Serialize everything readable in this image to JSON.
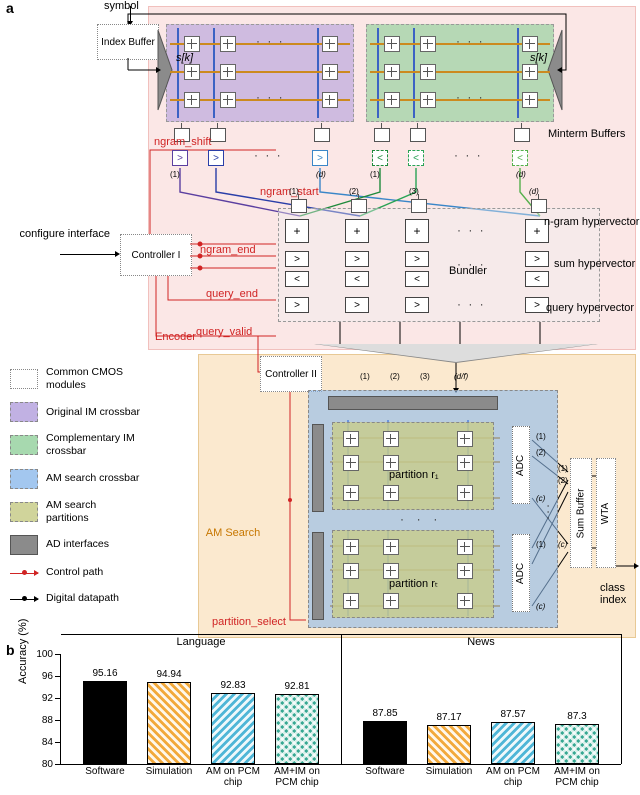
{
  "panel_a": {
    "symbol_label": "symbol",
    "index_buffer": "Index Buffer",
    "sk_left": "s[k]",
    "sk_right": "s[k]",
    "configure_if": "configure interface",
    "controller1": "Controller I",
    "controller2": "Controller II",
    "encoder_label": "Encoder",
    "am_label": "AM Search",
    "signals": {
      "ngram_shift": "ngram_shift",
      "ngram_start": "ngram_start",
      "ngram_end": "ngram_end",
      "query_end": "query_end",
      "query_valid": "query_valid",
      "partition_select": "partition_select"
    },
    "side_labels": {
      "minterm": "Minterm Buffers",
      "ngram_hv": "n-gram hypervector",
      "sum_hv": "sum hypervector",
      "query_hv": "query hypervector",
      "bundler": "Bundler"
    },
    "am": {
      "partition1": "partition r₁",
      "partition2": "partition rₜ",
      "adc": "ADC",
      "sumbuffer": "Sum Buffer",
      "wta": "WTA",
      "class_out": "class index"
    },
    "indices": {
      "one": "(1)",
      "two": "(2)",
      "three": "(3)",
      "d": "(d)",
      "c": "(c)",
      "df": "(d/f)"
    }
  },
  "legend": {
    "cmos": "Common CMOS modules",
    "orig_im": "Original IM crossbar",
    "comp_im": "Complementary IM crossbar",
    "am_xbar": "AM search crossbar",
    "am_part": "AM search partitions",
    "ad_if": "AD interfaces",
    "ctrl_path": "Control path",
    "data_path": "Digital datapath"
  },
  "chart_data": {
    "type": "bar",
    "ylabel": "Accuracy (%)",
    "ylim": [
      80,
      100
    ],
    "yticks": [
      80,
      84,
      88,
      92,
      96,
      100
    ],
    "segments": [
      "Language",
      "News"
    ],
    "categories": [
      "Software",
      "Simulation",
      "AM on PCM chip",
      "AM+IM on PCM chip"
    ],
    "series": [
      {
        "segment": "Language",
        "values": [
          95.16,
          94.94,
          92.83,
          92.81
        ],
        "colors": [
          "black",
          "orange",
          "cyan",
          "teal"
        ]
      },
      {
        "segment": "News",
        "values": [
          87.85,
          87.17,
          87.57,
          87.3
        ],
        "colors": [
          "black",
          "orange",
          "cyan",
          "teal"
        ]
      }
    ]
  }
}
